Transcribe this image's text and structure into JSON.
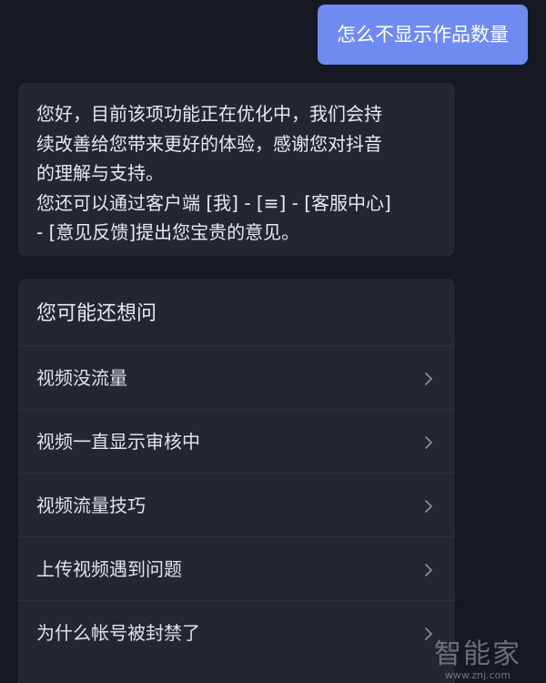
{
  "user_message": {
    "text": "怎么不显示作品数量"
  },
  "bot_message": {
    "lines": [
      "您好，目前该项功能正在优化中，我们会持",
      "续改善给您带来更好的体验，感谢您对抖音",
      "的理解与支持。",
      "您还可以通过客户端 [我] - [≡] - [客服中心]",
      "- [意见反馈]提出您宝贵的意见。"
    ]
  },
  "suggestions": {
    "title": "您可能还想问",
    "items": [
      {
        "label": "视频没流量"
      },
      {
        "label": "视频一直显示审核中"
      },
      {
        "label": "视频流量技巧"
      },
      {
        "label": "上传视频遇到问题"
      },
      {
        "label": "为什么帐号被封禁了"
      }
    ]
  },
  "watermark": {
    "text_cn": "智能家",
    "text_url": "www.znj.com"
  },
  "colors": {
    "background": "#161823",
    "user_bubble": "#6f8bf2",
    "card": "#242631"
  },
  "icons": {
    "chevron": "chevron-right-icon"
  }
}
